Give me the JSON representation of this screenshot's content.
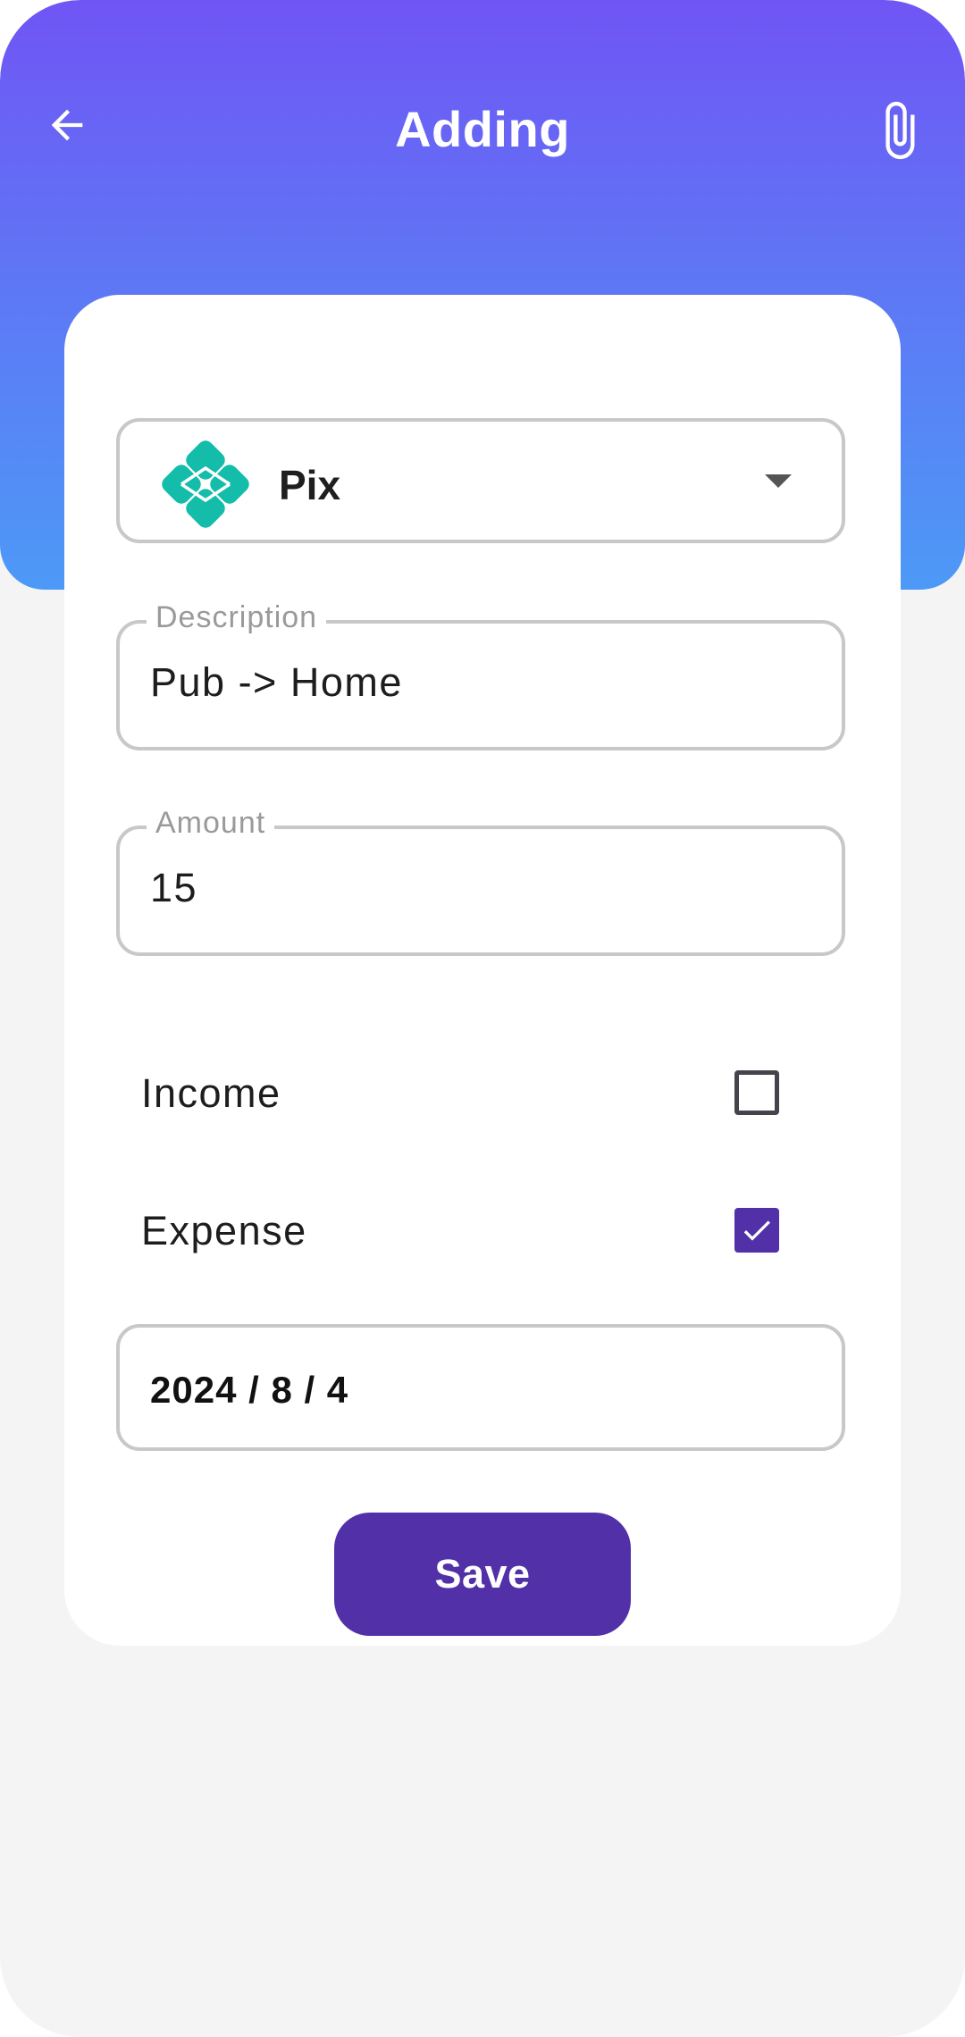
{
  "header": {
    "title": "Adding",
    "back_icon": "arrow-left-icon",
    "attach_icon": "paperclip-icon"
  },
  "payment_method": {
    "selected": "Pix",
    "icon": "pix-logo-icon"
  },
  "description": {
    "label": "Description",
    "value": "Pub -> Home"
  },
  "amount": {
    "label": "Amount",
    "value": "15"
  },
  "type": {
    "income": {
      "label": "Income",
      "checked": false
    },
    "expense": {
      "label": "Expense",
      "checked": true
    }
  },
  "date": {
    "value": "2024 / 8 / 4"
  },
  "actions": {
    "save_label": "Save"
  },
  "colors": {
    "header_gradient_top": "#7055f5",
    "header_gradient_bottom": "#4d99f7",
    "primary": "#5130a8",
    "pix_teal": "#13bdaa"
  }
}
